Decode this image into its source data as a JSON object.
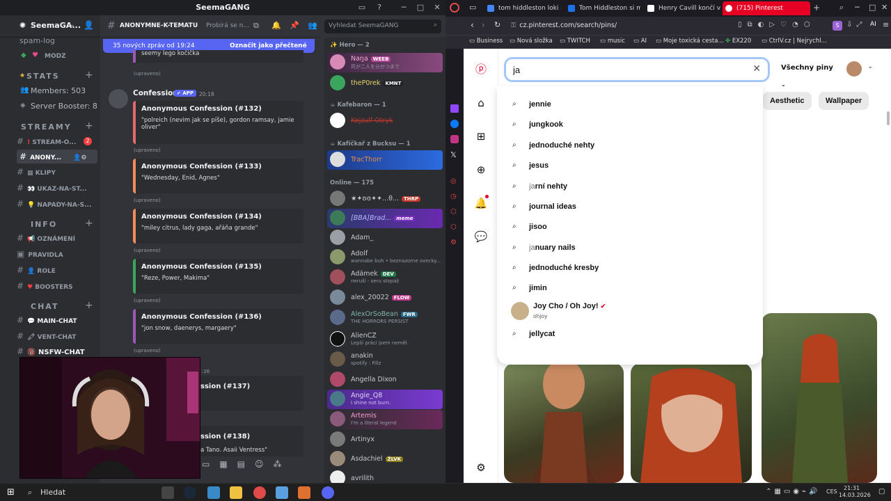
{
  "discord": {
    "window_title": "SeemaGANG",
    "server_name": "SeemaGA...",
    "channel_header": "ANONYMNE-K-TEMATU",
    "channel_topic": "Probírá se n...",
    "search_placeholder": "Vyhledat SeemaGANG",
    "banner": {
      "text": "35 nových zpráv od 19:24",
      "action": "Označit jako přečtené"
    },
    "sidebar": {
      "top_channels": [
        "spam-log",
        "MODZ"
      ],
      "stats_category": "STATS",
      "members_stat": "Members: 503",
      "booster_stat": "Server Booster: 8",
      "streamy_category": "STREAMY",
      "streamy_channels": [
        "STREAM-O...",
        "ANONY...",
        "KLIPY",
        "UKAZ-NA-ST...",
        "NAPADY-NA-S..."
      ],
      "stream_badge": "2",
      "info_category": "INFO",
      "info_channels": [
        "OZNÁMENÍ",
        "PRAVIDLA",
        "ROLE",
        "BOOSTERS"
      ],
      "chat_category": "CHAT",
      "chat_channels": [
        "MAIN-CHAT",
        "VENT-CHAT",
        "NSFW-Chat"
      ]
    },
    "messages": {
      "top_snippet": "seemy lego kočička",
      "edited": "(upraveno)",
      "author": "Confessions",
      "app_tag": "APP",
      "time": "20:18",
      "time2": ":26",
      "confessions": [
        {
          "title": "Anonymous Confession (#132)",
          "body": "\"polreich (nevim jak se píše), gordon ramsay, jamie oliver\"",
          "color": "#e26a6a"
        },
        {
          "title": "Anonymous Confession (#133)",
          "body": "\"Wednesday, Enid, Agnes\"",
          "color": "#f08c5a"
        },
        {
          "title": "Anonymous Confession (#134)",
          "body": "\"miley citrus, lady gaga, ařáňa grande\"",
          "color": "#f08c5a"
        },
        {
          "title": "Anonymous Confession (#135)",
          "body": "\"Reze, Power, Makima\"",
          "color": "#3ba55d"
        },
        {
          "title": "Anonymous Confession (#136)",
          "body": "\"jon snow, daenerys, margaery\"",
          "color": "#9b59b6"
        }
      ],
      "partial1": "ssion (#137)",
      "partial2": "ssion (#138)",
      "partial2_body": "a Tano. Asaii Ventress\""
    },
    "members": {
      "group_hero": "Hero — 2",
      "group_kafebaron": "Kafebaron — 1",
      "group_kaficka": "Kafíčkař z Bucksu — 1",
      "group_online": "Online — 175",
      "list": [
        {
          "name": "Naŋa",
          "tag": "WEEB",
          "status": "死が二人を分かつまで"
        },
        {
          "name": "theP0rek",
          "tag": "KMNT",
          "status": ""
        },
        {
          "name": "Kejzulf Otryk",
          "tag": "",
          "status": ""
        },
        {
          "name": "TracThorr",
          "tag": "",
          "status": ""
        },
        {
          "name": "★✦ʚɞ✦✦...θ...",
          "tag": "THRP",
          "status": ""
        },
        {
          "name": "[BBA]Brad...",
          "tag": "meme",
          "status": ""
        },
        {
          "name": "Adam_",
          "tag": "",
          "status": ""
        },
        {
          "name": "Adolf",
          "tag": "",
          "status": "wannabe buh • beznazorne ovecky..."
        },
        {
          "name": "Adámek",
          "tag": "DEV",
          "status": "neruší - seru stopáž"
        },
        {
          "name": "alex_20022",
          "tag": "FLOW",
          "status": ""
        },
        {
          "name": "AlexOrSoBean",
          "tag": "FWR",
          "status": "THE HORRORS PERSIST"
        },
        {
          "name": "AlienCZ",
          "tag": "",
          "status": "Lepší práci jsem neměl."
        },
        {
          "name": "anakin",
          "tag": "",
          "status": "spotify : Fillz"
        },
        {
          "name": "Angella Dixon",
          "tag": "",
          "status": ""
        },
        {
          "name": "Angie_Q8",
          "tag": "",
          "status": "I shine not burn."
        },
        {
          "name": "Artemis",
          "tag": "",
          "status": "I'm a literal legend"
        },
        {
          "name": "Artinyx",
          "tag": "",
          "status": ""
        },
        {
          "name": "Asdachiel",
          "tag": "ŽLVK",
          "status": ""
        },
        {
          "name": "avrilith",
          "tag": "",
          "status": ""
        }
      ]
    }
  },
  "browser": {
    "tabs": [
      {
        "label": "tom hiddleston loki - Gi",
        "color": "#4285f4"
      },
      {
        "label": "Tom Hiddleston si mys",
        "color": "#1a73e8"
      },
      {
        "label": "Henry Cavill končí v su",
        "color": "#ffffff"
      },
      {
        "label": "(715) Pinterest",
        "color": "#ffffff"
      }
    ],
    "url": "cz.pinterest.com/search/pins/",
    "bookmarks": [
      "Business",
      "Nová složka",
      "TWITCH",
      "music",
      "AI",
      "Moje toxická cesta...",
      "EX220",
      "CtrlV.cz | Nejrychl..."
    ],
    "pinterest": {
      "search_value": "ja",
      "filter_label": "Všechny piny",
      "chips": [
        "Aesthetic",
        "Wallpaper"
      ],
      "suggestions": [
        {
          "prefix": "",
          "rest": "jennie"
        },
        {
          "prefix": "",
          "rest": "jungkook"
        },
        {
          "prefix": "",
          "rest": "jednoduché nehty"
        },
        {
          "prefix": "",
          "rest": "jesus"
        },
        {
          "prefix": "ja",
          "rest": "rní nehty"
        },
        {
          "prefix": "",
          "rest": "journal ideas"
        },
        {
          "prefix": "",
          "rest": "jisoo"
        },
        {
          "prefix": "ja",
          "rest": "nuary nails"
        },
        {
          "prefix": "",
          "rest": "jednoduché kresby"
        },
        {
          "prefix": "",
          "rest": "jimin"
        }
      ],
      "profile_suggestion": {
        "name": "Joy Cho / Oh Joy!",
        "handle": "ohjoy"
      },
      "last_suggestion": "jellycat"
    }
  },
  "taskbar": {
    "search": "Hledat",
    "lang": "CES",
    "time": "21:31",
    "date": "14.03.2026"
  }
}
